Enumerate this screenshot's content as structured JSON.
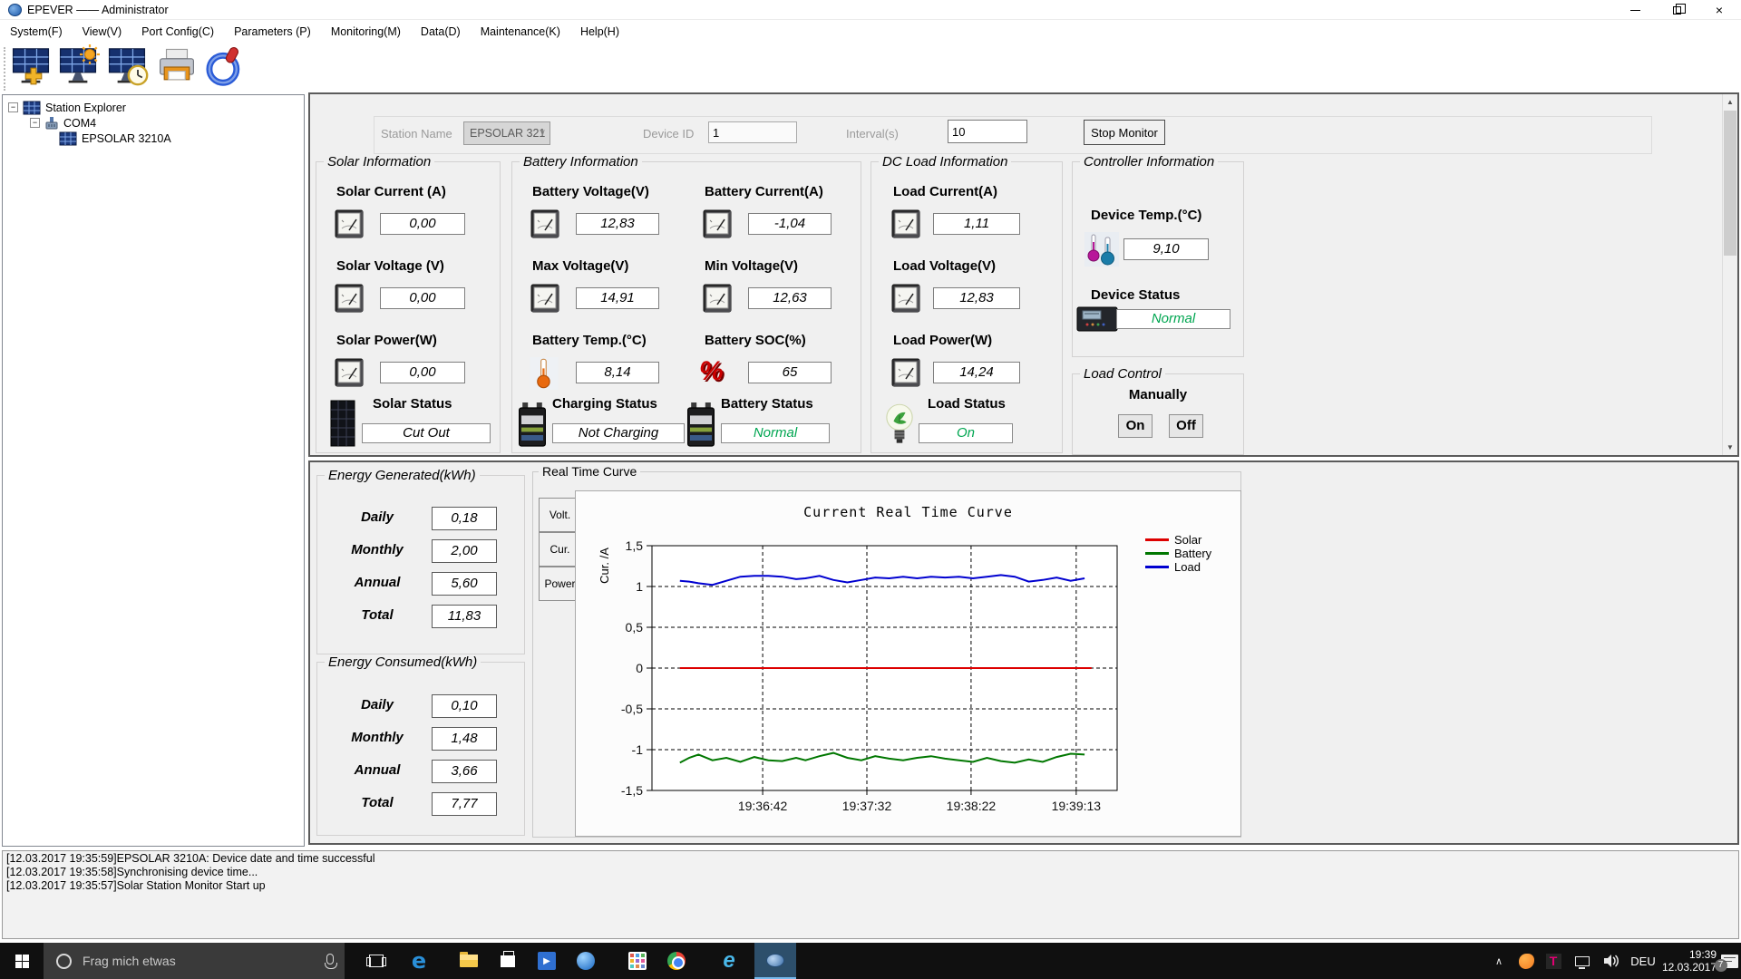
{
  "window": {
    "title": "EPEVER —— Administrator"
  },
  "menu": {
    "items": [
      "System(F)",
      "View(V)",
      "Port Config(C)",
      "Parameters (P)",
      "Monitoring(M)",
      "Data(D)",
      "Maintenance(K)",
      "Help(H)"
    ]
  },
  "toolbar": {
    "icons": [
      "add-station",
      "station-config",
      "device-time",
      "print",
      "power"
    ]
  },
  "tree": {
    "root": "Station Explorer",
    "port": "COM4",
    "device": "EPSOLAR 3210A"
  },
  "monitor_bar": {
    "station_name_label": "Station Name",
    "station_name_value": "EPSOLAR 321",
    "device_id_label": "Device ID",
    "device_id_value": "1",
    "interval_label": "Interval(s)",
    "interval_value": "10",
    "stop_button": "Stop Monitor"
  },
  "solar": {
    "title": "Solar Information",
    "rows": [
      {
        "label": "Solar Current (A)",
        "value": "0,00"
      },
      {
        "label": "Solar Voltage (V)",
        "value": "0,00"
      },
      {
        "label": "Solar Power(W)",
        "value": "0,00"
      }
    ],
    "status_label": "Solar Status",
    "status_value": "Cut Out"
  },
  "battery": {
    "title": "Battery Information",
    "cells": [
      {
        "label": "Battery Voltage(V)",
        "value": "12,83"
      },
      {
        "label": "Battery Current(A)",
        "value": "-1,04"
      },
      {
        "label": "Max Voltage(V)",
        "value": "14,91"
      },
      {
        "label": "Min Voltage(V)",
        "value": "12,63"
      },
      {
        "label": "Battery Temp.(°C)",
        "value": "8,14"
      },
      {
        "label": "Battery SOC(%)",
        "value": "65"
      }
    ],
    "charging_status_label": "Charging Status",
    "charging_status_value": "Not Charging",
    "battery_status_label": "Battery Status",
    "battery_status_value": "Normal"
  },
  "dc_load": {
    "title": "DC Load Information",
    "rows": [
      {
        "label": "Load Current(A)",
        "value": "1,11"
      },
      {
        "label": "Load Voltage(V)",
        "value": "12,83"
      },
      {
        "label": "Load Power(W)",
        "value": "14,24"
      }
    ],
    "status_label": "Load Status",
    "status_value": "On"
  },
  "controller": {
    "title": "Controller Information",
    "temp_label": "Device Temp.(°C)",
    "temp_value": "9,10",
    "status_label": "Device Status",
    "status_value": "Normal"
  },
  "load_control": {
    "title": "Load Control",
    "manually_label": "Manually",
    "on_button": "On",
    "off_button": "Off"
  },
  "energy_generated": {
    "title": "Energy Generated(kWh)",
    "rows": [
      {
        "label": "Daily",
        "value": "0,18"
      },
      {
        "label": "Monthly",
        "value": "2,00"
      },
      {
        "label": "Annual",
        "value": "5,60"
      },
      {
        "label": "Total",
        "value": "11,83"
      }
    ]
  },
  "energy_consumed": {
    "title": "Energy Consumed(kWh)",
    "rows": [
      {
        "label": "Daily",
        "value": "0,10"
      },
      {
        "label": "Monthly",
        "value": "1,48"
      },
      {
        "label": "Annual",
        "value": "3,66"
      },
      {
        "label": "Total",
        "value": "7,77"
      }
    ]
  },
  "curve_panel": {
    "title": "Real Time Curve",
    "tabs": [
      "Volt.",
      "Cur.",
      "Power"
    ]
  },
  "chart_data": {
    "type": "line",
    "title": "Current Real Time Curve",
    "ylabel": "Cur. /A",
    "ylim": [
      -1.5,
      1.5
    ],
    "grid": "dashed",
    "legend_position": "top-right",
    "yticks": [
      {
        "value": 1.5,
        "label": "1,5"
      },
      {
        "value": 1,
        "label": "1"
      },
      {
        "value": 0.5,
        "label": "0,5"
      },
      {
        "value": 0,
        "label": "0"
      },
      {
        "value": -0.5,
        "label": "-0,5"
      },
      {
        "value": -1,
        "label": "-1"
      },
      {
        "value": -1.5,
        "label": "-1,5"
      }
    ],
    "xticks": [
      {
        "pos": 0.238,
        "label": "19:36:42"
      },
      {
        "pos": 0.462,
        "label": "19:37:32"
      },
      {
        "pos": 0.686,
        "label": "19:38:22"
      },
      {
        "pos": 0.912,
        "label": "19:39:13"
      }
    ],
    "legend": [
      {
        "name": "Solar",
        "color": "#dd0000"
      },
      {
        "name": "Battery",
        "color": "#007700"
      },
      {
        "name": "Load",
        "color": "#0000d0"
      }
    ],
    "series": [
      {
        "name": "Solar",
        "color": "#dd0000",
        "points": [
          [
            0.06,
            0
          ],
          [
            0.945,
            0
          ]
        ]
      },
      {
        "name": "Battery",
        "color": "#007700",
        "points": [
          [
            0.06,
            -1.16
          ],
          [
            0.08,
            -1.1
          ],
          [
            0.1,
            -1.06
          ],
          [
            0.13,
            -1.13
          ],
          [
            0.16,
            -1.1
          ],
          [
            0.19,
            -1.15
          ],
          [
            0.22,
            -1.09
          ],
          [
            0.25,
            -1.13
          ],
          [
            0.28,
            -1.14
          ],
          [
            0.31,
            -1.1
          ],
          [
            0.33,
            -1.13
          ],
          [
            0.36,
            -1.08
          ],
          [
            0.39,
            -1.04
          ],
          [
            0.42,
            -1.1
          ],
          [
            0.45,
            -1.13
          ],
          [
            0.48,
            -1.08
          ],
          [
            0.51,
            -1.11
          ],
          [
            0.54,
            -1.13
          ],
          [
            0.57,
            -1.1
          ],
          [
            0.6,
            -1.08
          ],
          [
            0.63,
            -1.11
          ],
          [
            0.66,
            -1.13
          ],
          [
            0.69,
            -1.15
          ],
          [
            0.72,
            -1.1
          ],
          [
            0.75,
            -1.14
          ],
          [
            0.78,
            -1.16
          ],
          [
            0.81,
            -1.12
          ],
          [
            0.84,
            -1.15
          ],
          [
            0.87,
            -1.09
          ],
          [
            0.9,
            -1.05
          ],
          [
            0.93,
            -1.06
          ]
        ]
      },
      {
        "name": "Load",
        "color": "#0000d0",
        "points": [
          [
            0.06,
            1.07
          ],
          [
            0.08,
            1.06
          ],
          [
            0.1,
            1.04
          ],
          [
            0.13,
            1.02
          ],
          [
            0.16,
            1.07
          ],
          [
            0.19,
            1.12
          ],
          [
            0.22,
            1.13
          ],
          [
            0.25,
            1.13
          ],
          [
            0.28,
            1.12
          ],
          [
            0.31,
            1.09
          ],
          [
            0.33,
            1.1
          ],
          [
            0.36,
            1.13
          ],
          [
            0.39,
            1.08
          ],
          [
            0.42,
            1.05
          ],
          [
            0.45,
            1.08
          ],
          [
            0.48,
            1.11
          ],
          [
            0.51,
            1.1
          ],
          [
            0.54,
            1.12
          ],
          [
            0.57,
            1.1
          ],
          [
            0.6,
            1.12
          ],
          [
            0.63,
            1.11
          ],
          [
            0.66,
            1.12
          ],
          [
            0.69,
            1.1
          ],
          [
            0.72,
            1.12
          ],
          [
            0.75,
            1.14
          ],
          [
            0.78,
            1.12
          ],
          [
            0.81,
            1.06
          ],
          [
            0.84,
            1.08
          ],
          [
            0.87,
            1.11
          ],
          [
            0.9,
            1.07
          ],
          [
            0.93,
            1.1
          ]
        ]
      }
    ]
  },
  "log": {
    "lines": [
      "[12.03.2017 19:35:59]EPSOLAR 3210A: Device date and time successful",
      "[12.03.2017 19:35:58]Synchronising device time...",
      "[12.03.2017 19:35:57]Solar Station Monitor Start up"
    ]
  },
  "taskbar": {
    "search_placeholder": "Frag mich etwas",
    "language": "DEU",
    "time": "19:39",
    "date": "12.03.2017",
    "notification_count": "7"
  },
  "icons": {
    "minus": "−",
    "chevron_down": "∨",
    "chevron_up": "∧",
    "close": "×",
    "arrow_up": "▲",
    "arrow_down": "▼",
    "percent": "%",
    "play": "▶",
    "edge_letter": "e",
    "ie_letter": "e",
    "telekom_letter": "T"
  }
}
